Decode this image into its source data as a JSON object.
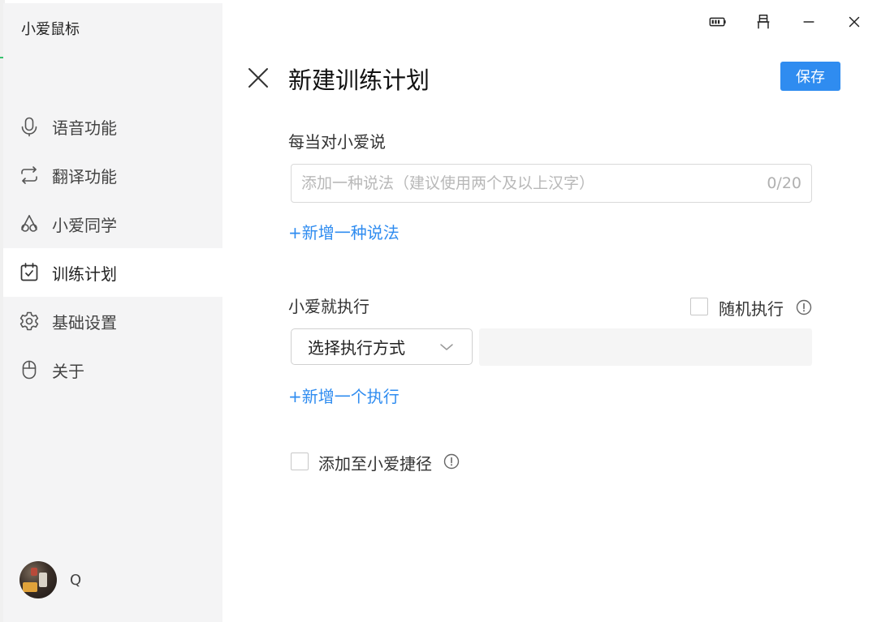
{
  "app": {
    "title": "小爱鼠标"
  },
  "sidebar": {
    "items": [
      {
        "id": "voice",
        "label": "语音功能",
        "icon": "microphone-icon",
        "active": false
      },
      {
        "id": "translate",
        "label": "翻译功能",
        "icon": "translate-icon",
        "active": false
      },
      {
        "id": "xiaoai",
        "label": "小爱同学",
        "icon": "xiaoai-icon",
        "active": false
      },
      {
        "id": "training",
        "label": "训练计划",
        "icon": "calendar-check-icon",
        "active": true
      },
      {
        "id": "settings",
        "label": "基础设置",
        "icon": "gear-icon",
        "active": false
      },
      {
        "id": "about",
        "label": "关于",
        "icon": "mouse-icon",
        "active": false
      }
    ],
    "user": {
      "name": "Q"
    }
  },
  "window_controls": [
    "battery-icon",
    "pin-icon",
    "minimize-icon",
    "close-icon"
  ],
  "main": {
    "title": "新建训练计划",
    "save_label": "保存",
    "trigger": {
      "label": "每当对小爱说",
      "input_value": "",
      "input_placeholder": "添加一种说法（建议使用两个及以上汉字）",
      "counter": "0/20",
      "add_link": "+新增一种说法"
    },
    "action": {
      "label": "小爱就执行",
      "random_label": "随机执行",
      "random_checked": false,
      "select_value": "选择执行方式",
      "add_link": "+新增一个执行"
    },
    "shortcut": {
      "label": "添加至小爱捷径",
      "checked": false
    }
  },
  "colors": {
    "accent": "#2f8cf0",
    "sidebar_bg": "#f4f4f5",
    "active_bg": "#ffffff"
  }
}
